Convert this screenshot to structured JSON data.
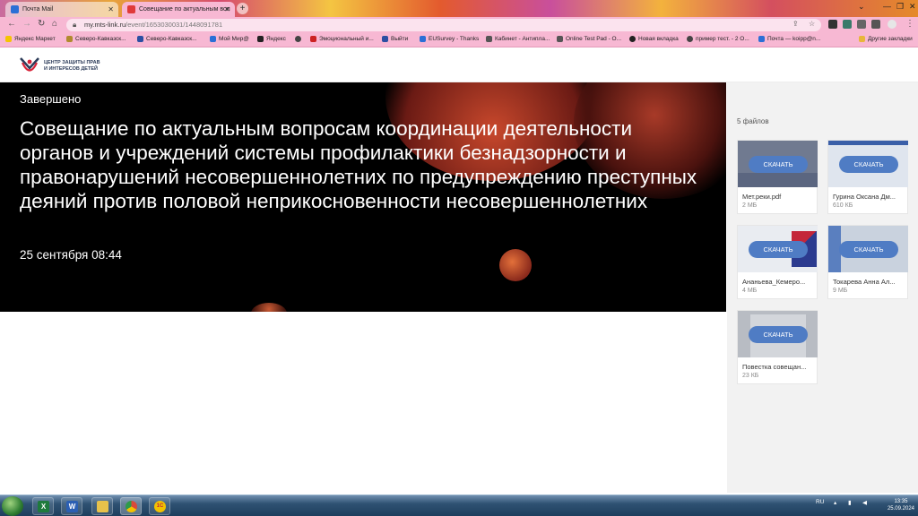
{
  "browser": {
    "tabs": [
      {
        "title": "Почта Mail",
        "active": false,
        "favicon_color": "#2b6fd6"
      },
      {
        "title": "Совещание по актуальным воп",
        "active": true,
        "favicon_color": "#e03a3a"
      }
    ],
    "new_tab_label": "+",
    "address": {
      "domain": "my.mts-link.ru",
      "path": "/event/1653030031/1448091781"
    },
    "bookmarks": [
      {
        "label": "Яндекс Маркет",
        "color": "#f5c400"
      },
      {
        "label": "Северо-Кавказск...",
        "color": "#b08a2e"
      },
      {
        "label": "Северо-Кавказск...",
        "color": "#2b4fa2"
      },
      {
        "label": "Мой Мир@",
        "color": "#2b6fd6"
      },
      {
        "label": "Яндекс",
        "color": "#222222"
      },
      {
        "label": "Эмоциональный и...",
        "color": "#cc2222"
      },
      {
        "label": "Выйти",
        "color": "#2b4fa2"
      },
      {
        "label": "EUSurvey - Thanks",
        "color": "#2b6fd6"
      },
      {
        "label": "Кабинет - Антипла...",
        "color": "#555555"
      },
      {
        "label": "Online Test Pad - O...",
        "color": "#555555"
      },
      {
        "label": "Новая вкладка",
        "color": "#222222"
      },
      {
        "label": "пример тест. - 2 О...",
        "color": "#444444"
      },
      {
        "label": "Почта — koipp@n...",
        "color": "#2b6fd6"
      },
      {
        "label": "Другие закладки",
        "color": "#e8b63a"
      }
    ]
  },
  "page": {
    "org_name_line1": "ЦЕНТР ЗАЩИТЫ ПРАВ",
    "org_name_line2": "И ИНТЕРЕСОВ ДЕТЕЙ",
    "event": {
      "status": "Завершено",
      "title": "Совещание по актуальным вопросам координации деятельности органов и учреждений системы профилактики безнадзорности и правонарушений несовершеннолетних по предупреждению преступных деяний против половой неприкосновенности несовершеннолетних",
      "datetime": "25 сентября 08:44"
    },
    "files_count": "5 файлов",
    "download_label": "СКАЧАТЬ",
    "files": [
      {
        "name": "Мет.реки.pdf",
        "size": "2 МБ"
      },
      {
        "name": "Гурина Оксана Дм...",
        "size": "610 КБ"
      },
      {
        "name": "Ананьева_Кемеро...",
        "size": "4 МБ"
      },
      {
        "name": "Токарева Анна Ал...",
        "size": "9 МБ"
      },
      {
        "name": "Повестка совещан...",
        "size": "23 КБ"
      }
    ]
  },
  "taskbar": {
    "apps": [
      {
        "name": "excel",
        "label": "X",
        "color": "#1e7a3c"
      },
      {
        "name": "word",
        "label": "W",
        "color": "#2b5fb3"
      },
      {
        "name": "explorer",
        "label": "",
        "color": "#e8c24a"
      },
      {
        "name": "chrome",
        "label": "",
        "color": "#d94a3a"
      },
      {
        "name": "1c",
        "label": "1С",
        "color": "#f2c200"
      }
    ],
    "language": "RU",
    "time": "13:35",
    "date": "25.09.2024"
  }
}
